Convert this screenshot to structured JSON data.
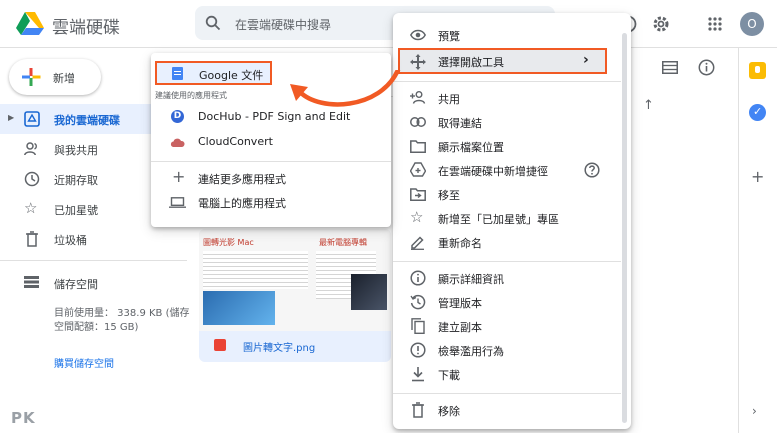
{
  "app": {
    "title": "雲端硬碟"
  },
  "search": {
    "placeholder": "在雲端硬碟中搜尋"
  },
  "header": {
    "avatar_letter": "O"
  },
  "new_button": {
    "label": "新增"
  },
  "sidebar": {
    "items": [
      {
        "label": "我的雲端硬碟",
        "icon": "my-drive-icon"
      },
      {
        "label": "與我共用",
        "icon": "shared-people-icon"
      },
      {
        "label": "近期存取",
        "icon": "clock-icon"
      },
      {
        "label": "已加星號",
        "icon": "star-icon"
      },
      {
        "label": "垃圾桶",
        "icon": "trash-icon"
      }
    ],
    "storage": {
      "label": "儲存空間",
      "usage_line1": "目前使用量： 338.9 KB (儲存",
      "usage_line2": "空間配額：15 GB)",
      "buy_label": "購買儲存空間"
    }
  },
  "file": {
    "name": "圖片轉文字.png",
    "thumb_title_left": "圖轉光影 Mac",
    "thumb_title_right": "最新電腦專輯"
  },
  "open_with": {
    "google_docs": "Google 文件",
    "suggested_header": "建議使用的應用程式",
    "apps": [
      "DocHub - PDF Sign and Edit",
      "CloudConvert"
    ],
    "more_apps": "連結更多應用程式",
    "computer_apps": "電腦上的應用程式"
  },
  "context_menu": {
    "preview": "預覽",
    "open_with": "選擇開啟工具",
    "share": "共用",
    "get_link": "取得連結",
    "show_location": "顯示檔案位置",
    "add_shortcut": "在雲端硬碟中新增捷徑",
    "move_to": "移至",
    "add_star": "新增至「已加星號」專區",
    "rename": "重新命名",
    "details": "顯示詳細資訊",
    "manage_versions": "管理版本",
    "make_copy": "建立副本",
    "report_abuse": "檢舉濫用行為",
    "download": "下載",
    "remove": "移除"
  },
  "watermark": "PK",
  "colors": {
    "highlight": "#f15a24",
    "blue": "#1a73e8",
    "docs_blue": "#4285f4"
  }
}
